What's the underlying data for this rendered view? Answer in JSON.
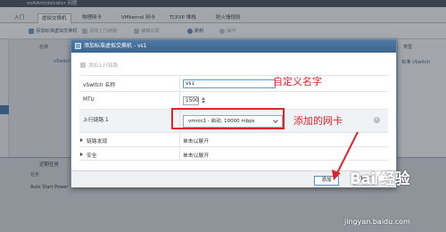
{
  "app": {
    "title_fragment": "vcAdministrator 问题"
  },
  "tabs": [
    "入门",
    "虚拟交换机",
    "物理网卡",
    "VMkernel 网卡",
    "TCP/IP 堆栈",
    "防火墙规则"
  ],
  "toolbar": {
    "add_switch": "添加标准虚拟交换机",
    "add_uplink": "添加上行链路",
    "edit_settings": "编辑设置",
    "refresh": "刷新",
    "actions": "操作"
  },
  "list": {
    "col_name": "名称",
    "col_type": "类型",
    "row_name": "vSwitch0",
    "row_type": "标准 vSwitch"
  },
  "bottom_panel": {
    "title": "近期任务",
    "col_task": "任务",
    "row_text": "Auto Start Power"
  },
  "dialog": {
    "title": "添加标准虚拟交换机 - vs1",
    "add_uplink_link": "添加上行链路",
    "fields": {
      "vswitch_name_label": "vSwitch 名称",
      "vswitch_name_value": "vs1",
      "mtu_label": "MTU",
      "mtu_value": "1500",
      "uplink_label": "上行链路 1",
      "uplink_value": "vmnic1 - 启动, 10000 mbps",
      "link_discovery_label": "链路发现",
      "link_discovery_value": "单击以展开",
      "security_label": "安全",
      "security_value": "单击以展开"
    },
    "buttons": {
      "add": "添加",
      "cancel": "取消"
    }
  },
  "annotations": {
    "custom_name": "自定义名字",
    "added_nic": "添加的网卡"
  },
  "watermark": {
    "logo": "Bai 经验",
    "site": "jingyan.baidu.com"
  },
  "colors": {
    "annotation_red": "#e1242a",
    "dialog_header": "#3c6690",
    "focus_blue": "#5b9bd5"
  }
}
